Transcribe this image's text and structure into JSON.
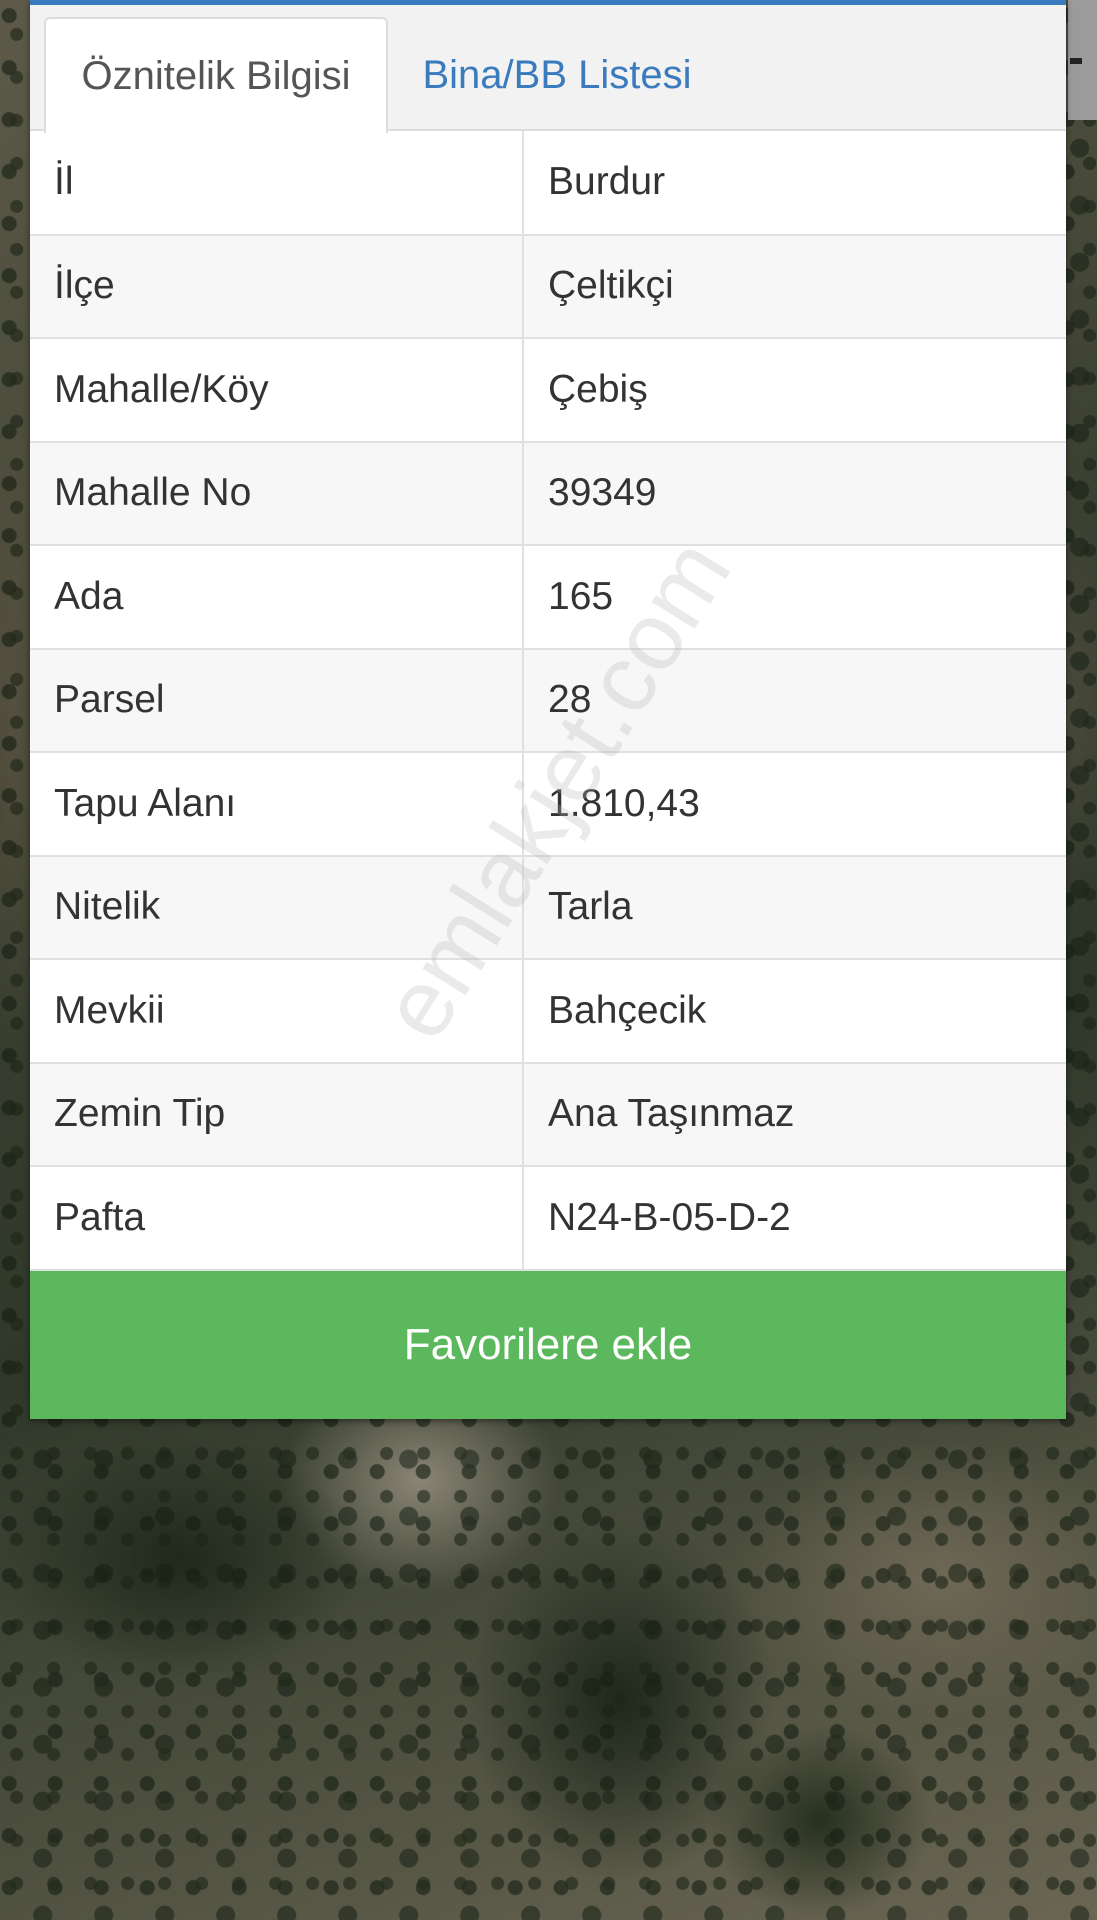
{
  "tabs": [
    {
      "label": "Öznitelik Bilgisi",
      "active": true
    },
    {
      "label": "Bina/BB Listesi",
      "active": false
    }
  ],
  "attributes": [
    {
      "key": "İl",
      "value": "Burdur"
    },
    {
      "key": "İlçe",
      "value": "Çeltikçi"
    },
    {
      "key": "Mahalle/Köy",
      "value": "Çebiş"
    },
    {
      "key": "Mahalle No",
      "value": "39349"
    },
    {
      "key": "Ada",
      "value": "165"
    },
    {
      "key": "Parsel",
      "value": "28"
    },
    {
      "key": "Tapu Alanı",
      "value": "1.810,43"
    },
    {
      "key": "Nitelik",
      "value": "Tarla"
    },
    {
      "key": "Mevkii",
      "value": "Bahçecik"
    },
    {
      "key": "Zemin Tip",
      "value": "Ana Taşınmaz"
    },
    {
      "key": "Pafta",
      "value": "N24-B-05-D-2"
    }
  ],
  "favorite_button": {
    "label": "Favorilere ekle"
  },
  "watermark": "emlakjet.com",
  "colors": {
    "accent": "#3a7bbd",
    "button": "#5cb85c"
  }
}
